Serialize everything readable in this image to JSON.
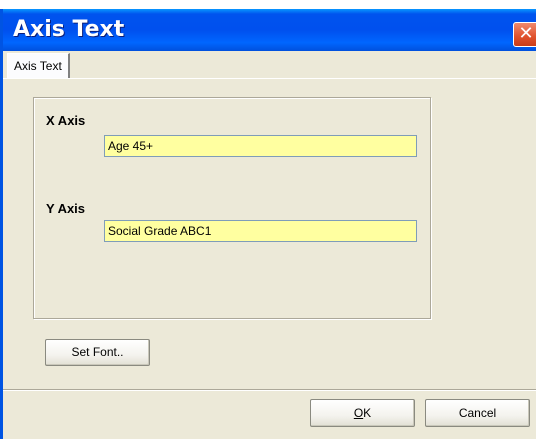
{
  "window": {
    "title": "Axis Text",
    "close_glyph": "✕"
  },
  "tabs": [
    {
      "label": "Axis Text",
      "active": true
    }
  ],
  "x_axis": {
    "label": "X Axis",
    "value": "Age 45+"
  },
  "y_axis": {
    "label": "Y Axis",
    "value": "Social Grade ABC1"
  },
  "buttons": {
    "set_font": "Set Font..",
    "ok_mnemonic": "O",
    "ok_rest": "K",
    "cancel": "Cancel"
  },
  "colors": {
    "title_bar": "#0054e3",
    "dialog_bg": "#ece9d8",
    "input_bg": "#ffffa0",
    "close_button": "#e0512c"
  },
  "icons": [
    "close-icon"
  ]
}
